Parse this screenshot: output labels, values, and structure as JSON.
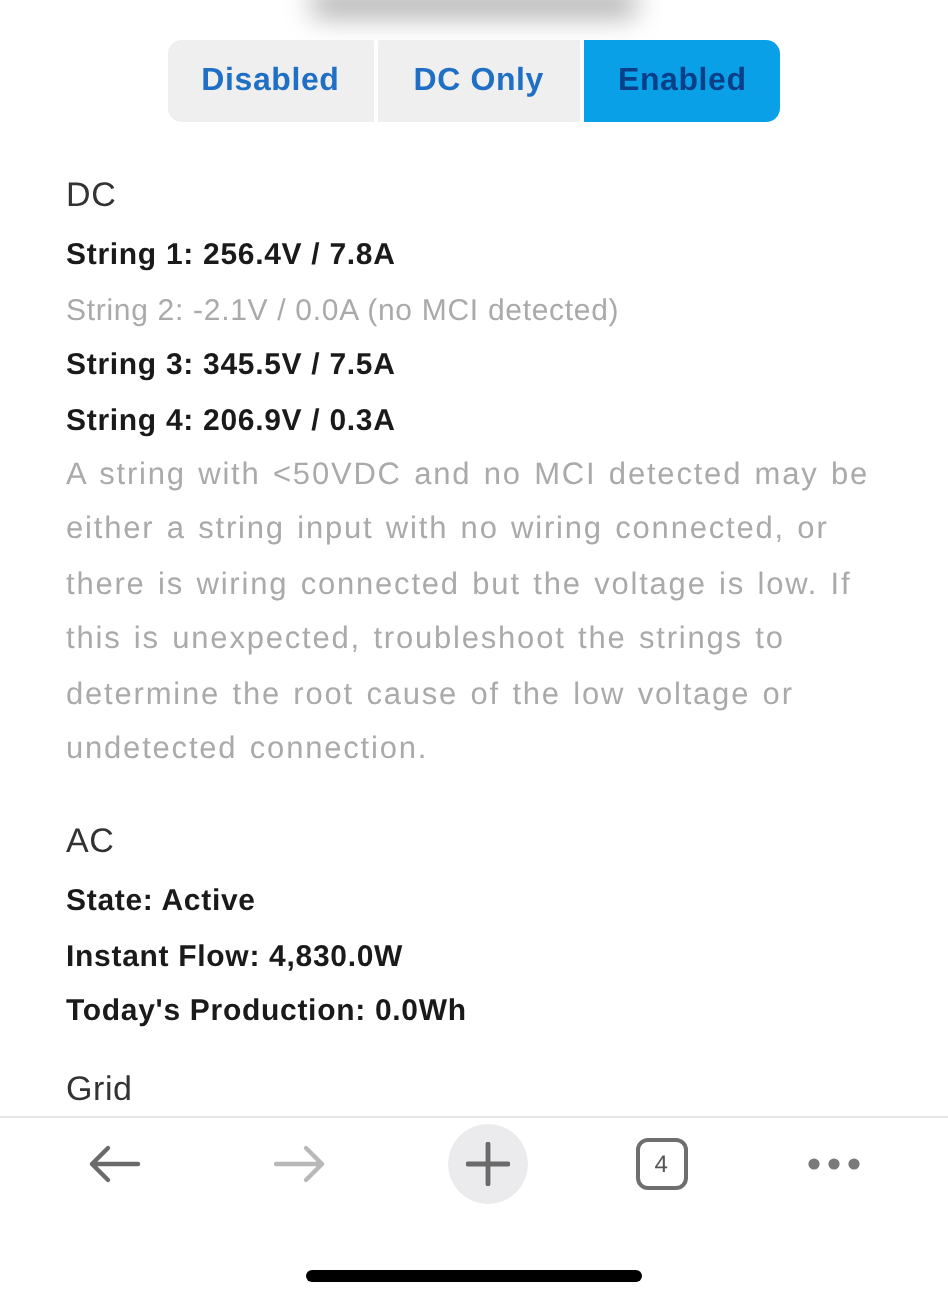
{
  "mode_selector": [
    {
      "label": "Disabled",
      "selected": false
    },
    {
      "label": "DC Only",
      "selected": false
    },
    {
      "label": "Enabled",
      "selected": true
    }
  ],
  "dc": {
    "heading": "DC",
    "strings": [
      {
        "text": "String 1: 256.4V / 7.8A",
        "disabled": false
      },
      {
        "text": "String 2: -2.1V / 0.0A (no MCI detected)",
        "disabled": true
      },
      {
        "text": "String 3: 345.5V / 7.5A",
        "disabled": false
      },
      {
        "text": "String 4: 206.9V / 0.3A",
        "disabled": false
      }
    ],
    "note": "A string with <50VDC and no MCI detected may be either a string input with no wiring connected, or there is wiring connected but the voltage is low. If this is unexpected, troubleshoot the strings to determine the root cause of the low voltage or undetected connection."
  },
  "ac": {
    "heading": "AC",
    "lines": [
      "State: Active",
      "Instant Flow: 4,830.0W",
      "Today's Production: 0.0Wh"
    ]
  },
  "grid": {
    "heading": "Grid"
  },
  "browser_toolbar": {
    "back_enabled": true,
    "forward_enabled": false,
    "tab_count": "4"
  }
}
